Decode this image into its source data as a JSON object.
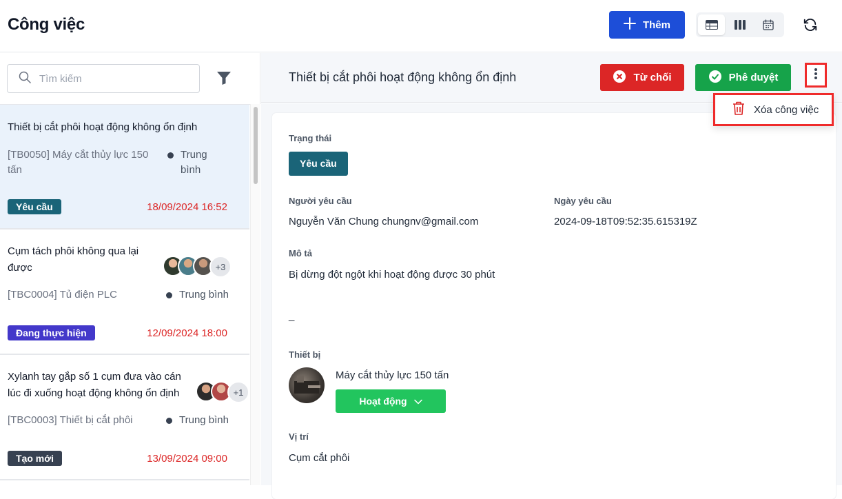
{
  "header": {
    "title": "Công việc",
    "add_label": "Thêm",
    "views": [
      "table-view-icon",
      "kanban-view-icon",
      "calendar-view-icon"
    ],
    "active_view": "table-view-icon"
  },
  "sidebar": {
    "search_placeholder": "Tìm kiếm",
    "items": [
      {
        "title": "Thiết bị cắt phôi hoạt động không ổn định",
        "device": "[TB0050] Máy cắt thủy lực 150 tấn",
        "priority": "Trung bình",
        "status": "Yêu cầu",
        "status_color": "#1a6478",
        "date": "18/09/2024 16:52",
        "selected": true
      },
      {
        "title": "Cụm tách phôi không qua lại được",
        "device": "[TBC0004] Tủ điện PLC",
        "priority": "Trung bình",
        "status": "Đang thực hiện",
        "status_color": "#4338ca",
        "date": "12/09/2024 18:00",
        "assignees_more": "+3"
      },
      {
        "title": "Xylanh tay gắp số 1 cụm đưa vào cán lúc đi xuống hoạt động không ổn định",
        "device": "[TBC0003] Thiết bị cắt phôi",
        "priority": "Trung bình",
        "status": "Tạo mới",
        "status_color": "#374151",
        "date": "13/09/2024 09:00",
        "assignees_more": "+1"
      }
    ]
  },
  "detail": {
    "title": "Thiết bị cắt phôi hoạt động không ổn định",
    "reject_label": "Từ chối",
    "approve_label": "Phê duyệt",
    "menu_delete_label": "Xóa công việc",
    "status_label": "Trạng thái",
    "status_value": "Yêu cầu",
    "requester_label": "Người yêu cầu",
    "requester_value": "Nguyễn Văn Chung chungnv@gmail.com",
    "request_date_label": "Ngày yêu cầu",
    "request_date_value": "2024-09-18T09:52:35.615319Z",
    "description_label": "Mô tả",
    "description_value": "Bị dừng đột ngột khi hoạt động được 30 phút",
    "description_extra": "_",
    "equipment_label": "Thiết bị",
    "equipment_name": "Máy cắt thủy lực 150 tấn",
    "equipment_state": "Hoạt động",
    "location_label": "Vị trí",
    "location_value": "Cụm cắt phôi"
  },
  "colors": {
    "primary": "#1d4ed8",
    "reject": "#dc2626",
    "approve": "#16a34a",
    "highlight": "#ef2b2b"
  }
}
